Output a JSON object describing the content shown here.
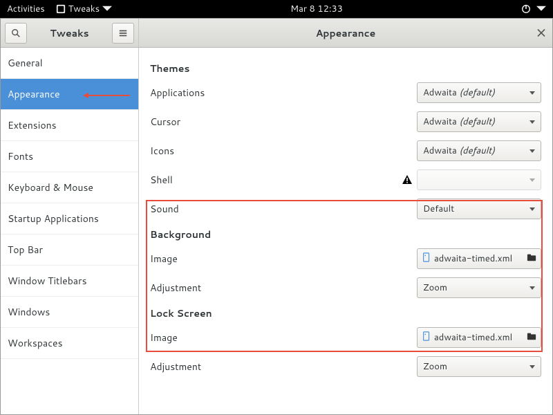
{
  "panel": {
    "activities": "Activities",
    "app_indicator": "Tweaks",
    "clock": "Mar 8  12:33"
  },
  "header": {
    "left_title": "Tweaks",
    "right_title": "Appearance"
  },
  "sidebar": {
    "items": [
      {
        "label": "General"
      },
      {
        "label": "Appearance"
      },
      {
        "label": "Extensions"
      },
      {
        "label": "Fonts"
      },
      {
        "label": "Keyboard & Mouse"
      },
      {
        "label": "Startup Applications"
      },
      {
        "label": "Top Bar"
      },
      {
        "label": "Window Titlebars"
      },
      {
        "label": "Windows"
      },
      {
        "label": "Workspaces"
      }
    ],
    "selected_index": 1
  },
  "content": {
    "sections": {
      "themes": {
        "title": "Themes",
        "applications": {
          "label": "Applications",
          "value": "Adwaita",
          "suffix": "(default)"
        },
        "cursor": {
          "label": "Cursor",
          "value": "Adwaita",
          "suffix": "(default)"
        },
        "icons": {
          "label": "Icons",
          "value": "Adwaita",
          "suffix": "(default)"
        },
        "shell": {
          "label": "Shell",
          "value": ""
        },
        "sound": {
          "label": "Sound",
          "value": "Default"
        }
      },
      "background": {
        "title": "Background",
        "image": {
          "label": "Image",
          "file": "adwaita-timed.xml"
        },
        "adjustment": {
          "label": "Adjustment",
          "value": "Zoom"
        }
      },
      "lockscreen": {
        "title": "Lock Screen",
        "image": {
          "label": "Image",
          "file": "adwaita-timed.xml"
        },
        "adjustment": {
          "label": "Adjustment",
          "value": "Zoom"
        }
      }
    }
  }
}
